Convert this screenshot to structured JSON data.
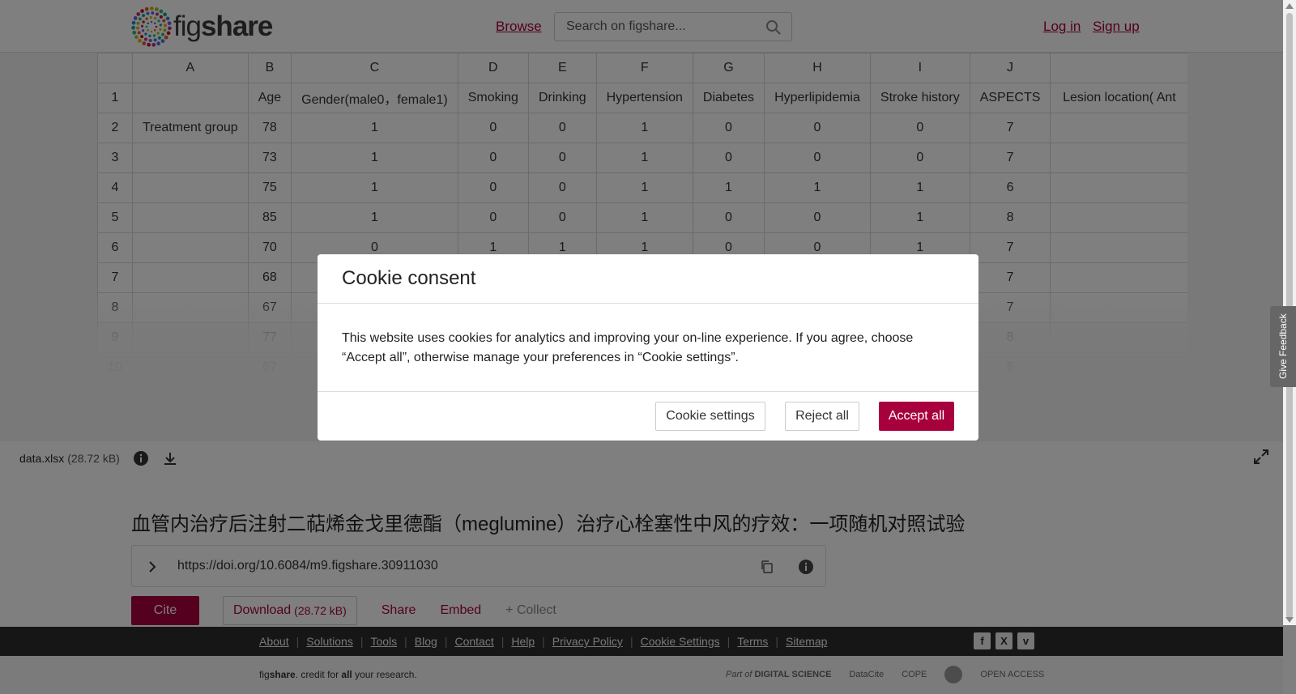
{
  "header": {
    "logo_text_pre": "fig",
    "logo_text_bold": "share",
    "browse": "Browse",
    "search_placeholder": "Search on figshare...",
    "login": "Log in",
    "signup": "Sign up"
  },
  "sheet": {
    "columns": [
      "",
      "A",
      "B",
      "C",
      "D",
      "E",
      "F",
      "G",
      "H",
      "I",
      "J",
      ""
    ],
    "rows": [
      [
        "1",
        "",
        "Age",
        "Gender(male0，female1)",
        "Smoking",
        "Drinking",
        "Hypertension",
        "Diabetes",
        "Hyperlipidemia",
        "Stroke history",
        "ASPECTS",
        "Lesion location( Ant"
      ],
      [
        "2",
        "Treatment group",
        "78",
        "1",
        "0",
        "0",
        "1",
        "0",
        "0",
        "0",
        "7",
        ""
      ],
      [
        "3",
        "",
        "73",
        "1",
        "0",
        "0",
        "1",
        "0",
        "0",
        "0",
        "7",
        ""
      ],
      [
        "4",
        "",
        "75",
        "1",
        "0",
        "0",
        "1",
        "1",
        "1",
        "1",
        "6",
        ""
      ],
      [
        "5",
        "",
        "85",
        "1",
        "0",
        "0",
        "1",
        "0",
        "0",
        "1",
        "8",
        ""
      ],
      [
        "6",
        "",
        "70",
        "0",
        "1",
        "1",
        "1",
        "0",
        "0",
        "1",
        "7",
        ""
      ],
      [
        "7",
        "",
        "68",
        "",
        "",
        "",
        "",
        "",
        "",
        "",
        "7",
        ""
      ],
      [
        "8",
        "",
        "67",
        "",
        "",
        "",
        "",
        "",
        "",
        "",
        "7",
        ""
      ],
      [
        "9",
        "",
        "77",
        "",
        "",
        "",
        "",
        "",
        "",
        "",
        "8",
        ""
      ],
      [
        "10",
        "",
        "67",
        "",
        "",
        "",
        "",
        "",
        "",
        "",
        "6",
        ""
      ]
    ]
  },
  "file": {
    "name": "data.xlsx",
    "size": "(28.72 kB)"
  },
  "article": {
    "title": "血管内治疗后注射二萜烯金戈里德酯（meglumine）治疗心栓塞性中风的疗效：一项随机对照试验",
    "doi": "https://doi.org/10.6084/m9.figshare.30911030",
    "cite": "Cite",
    "download": "Download",
    "download_size": "(28.72 kB)",
    "share": "Share",
    "embed": "Embed",
    "collect": "+ Collect"
  },
  "footer": {
    "links": [
      "About",
      "Solutions",
      "Tools",
      "Blog",
      "Contact",
      "Help",
      "Privacy Policy",
      "Cookie Settings",
      "Terms",
      "Sitemap"
    ],
    "tagline_pre": "fig",
    "tagline_bold": "share",
    "tagline_mid": ". credit for ",
    "tagline_all": "all",
    "tagline_end": " your research.",
    "part_of": "Part of",
    "digital_science": "DIGITAL SCIENCE",
    "datacite": "DataCite",
    "cope": "COPE",
    "open_access": "OPEN ACCESS"
  },
  "feedback": "Give Feedback",
  "cookie": {
    "title": "Cookie consent",
    "body": "This website uses cookies for analytics and improving your on-line experience. If you agree, choose “Accept all”, otherwise manage your preferences in “Cookie settings”.",
    "settings": "Cookie settings",
    "reject": "Reject all",
    "accept": "Accept all"
  },
  "colors": {
    "brand": "#a8003c",
    "footer_bg": "#2d2d2d"
  }
}
